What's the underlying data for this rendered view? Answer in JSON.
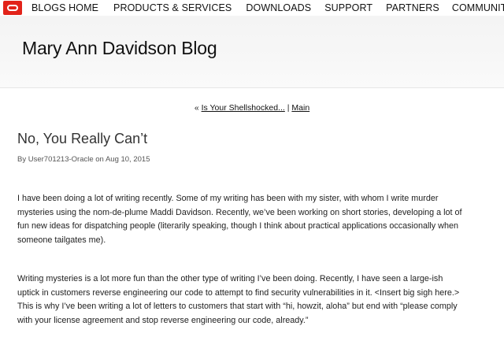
{
  "topnav": {
    "logo_icon": "oracle-logo-icon",
    "items": [
      "BLOGS HOME",
      "PRODUCTS & SERVICES",
      "DOWNLOADS",
      "SUPPORT",
      "PARTNERS",
      "COMMUNITIES"
    ]
  },
  "blog": {
    "title": "Mary Ann Davidson Blog"
  },
  "postnav": {
    "prefix": "« ",
    "prev_link": "Is Your Shellshocked...",
    "separator": " | ",
    "main_link": "Main"
  },
  "post": {
    "title": "No, You Really Can’t",
    "byline": "By User701213-Oracle on Aug 10, 2015",
    "paragraphs": [
      [
        "I have been doing a lot of writing recently. Some of my writing has been with my sister, with whom I write murder",
        "mysteries using the nom-de-plume Maddi Davidson. Recently, we’ve been working on short stories, developing a lot of",
        "fun new ideas for dispatching people (literarily speaking, though I think about practical applications occasionally when",
        "someone tailgates me)."
      ],
      [
        "Writing mysteries is a lot more fun than the other type of writing I’ve been doing. Recently, I have seen a large-ish",
        "uptick in customers reverse engineering our code to attempt to find security vulnerabilities in it. <Insert big sigh here.>",
        "This is why I’ve been writing a lot of letters to customers that start with “hi, howzit, aloha” but end with “please comply",
        "with your license agreement and stop reverse engineering our code, already.”"
      ]
    ]
  },
  "colors": {
    "logo_red": "#e2231a",
    "banner_bg": "#f4f4f4",
    "text": "#222222"
  }
}
